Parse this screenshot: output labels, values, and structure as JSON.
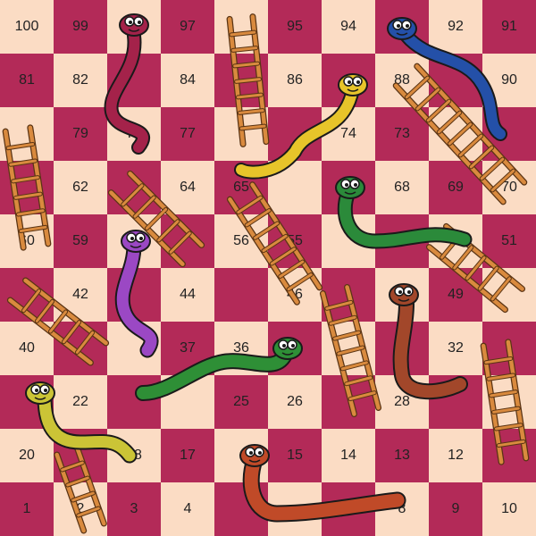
{
  "board": {
    "rows": [
      [
        "100",
        "99",
        "",
        "97",
        "",
        "95",
        "94",
        "",
        "92",
        "91"
      ],
      [
        "81",
        "82",
        "",
        "84",
        "",
        "86",
        "",
        "88",
        "",
        "90"
      ],
      [
        "",
        "79",
        "78",
        "77",
        "",
        "",
        "74",
        "73",
        "",
        ""
      ],
      [
        "",
        "62",
        "",
        "64",
        "65",
        "",
        "",
        "68",
        "69",
        "70"
      ],
      [
        "60",
        "59",
        "",
        "",
        "56",
        "55",
        "",
        "",
        "",
        "51"
      ],
      [
        "",
        "42",
        "",
        "44",
        "",
        "46",
        "",
        "",
        "49",
        ""
      ],
      [
        "40",
        "",
        "",
        "37",
        "36",
        "",
        "",
        "",
        "32",
        ""
      ],
      [
        "",
        "22",
        "",
        "",
        "25",
        "26",
        "",
        "28",
        "",
        ""
      ],
      [
        "20",
        "",
        "18",
        "17",
        "",
        "15",
        "14",
        "13",
        "12",
        ""
      ],
      [
        "1",
        "2",
        "3",
        "4",
        "",
        "",
        "",
        "8",
        "9",
        "10"
      ]
    ],
    "colors": {
      "light": "#fbdcc4",
      "dark": "#b32a58"
    }
  },
  "ladders": [
    {
      "name": "ladder-a",
      "color": "#d98a3e"
    },
    {
      "name": "ladder-b",
      "color": "#d98a3e"
    },
    {
      "name": "ladder-c",
      "color": "#d98a3e"
    },
    {
      "name": "ladder-d",
      "color": "#d98a3e"
    },
    {
      "name": "ladder-e",
      "color": "#d98a3e"
    },
    {
      "name": "ladder-f",
      "color": "#d98a3e"
    },
    {
      "name": "ladder-g",
      "color": "#d98a3e"
    },
    {
      "name": "ladder-h",
      "color": "#d98a3e"
    },
    {
      "name": "ladder-i",
      "color": "#d98a3e"
    },
    {
      "name": "ladder-j",
      "color": "#d98a3e"
    }
  ],
  "snakes": [
    {
      "name": "red-snake",
      "color": "#a4224a"
    },
    {
      "name": "blue-snake",
      "color": "#2450a8"
    },
    {
      "name": "yellow-snake",
      "color": "#e7c42a"
    },
    {
      "name": "green-snake",
      "color": "#2b8a3a"
    },
    {
      "name": "purple-snake",
      "color": "#9b48c4"
    },
    {
      "name": "brown-snake",
      "color": "#a2472a"
    },
    {
      "name": "spotted-green-snake",
      "color": "#2e8f36"
    },
    {
      "name": "olive-snake",
      "color": "#cbc436"
    },
    {
      "name": "striped-snake",
      "color": "#c04a28"
    }
  ]
}
